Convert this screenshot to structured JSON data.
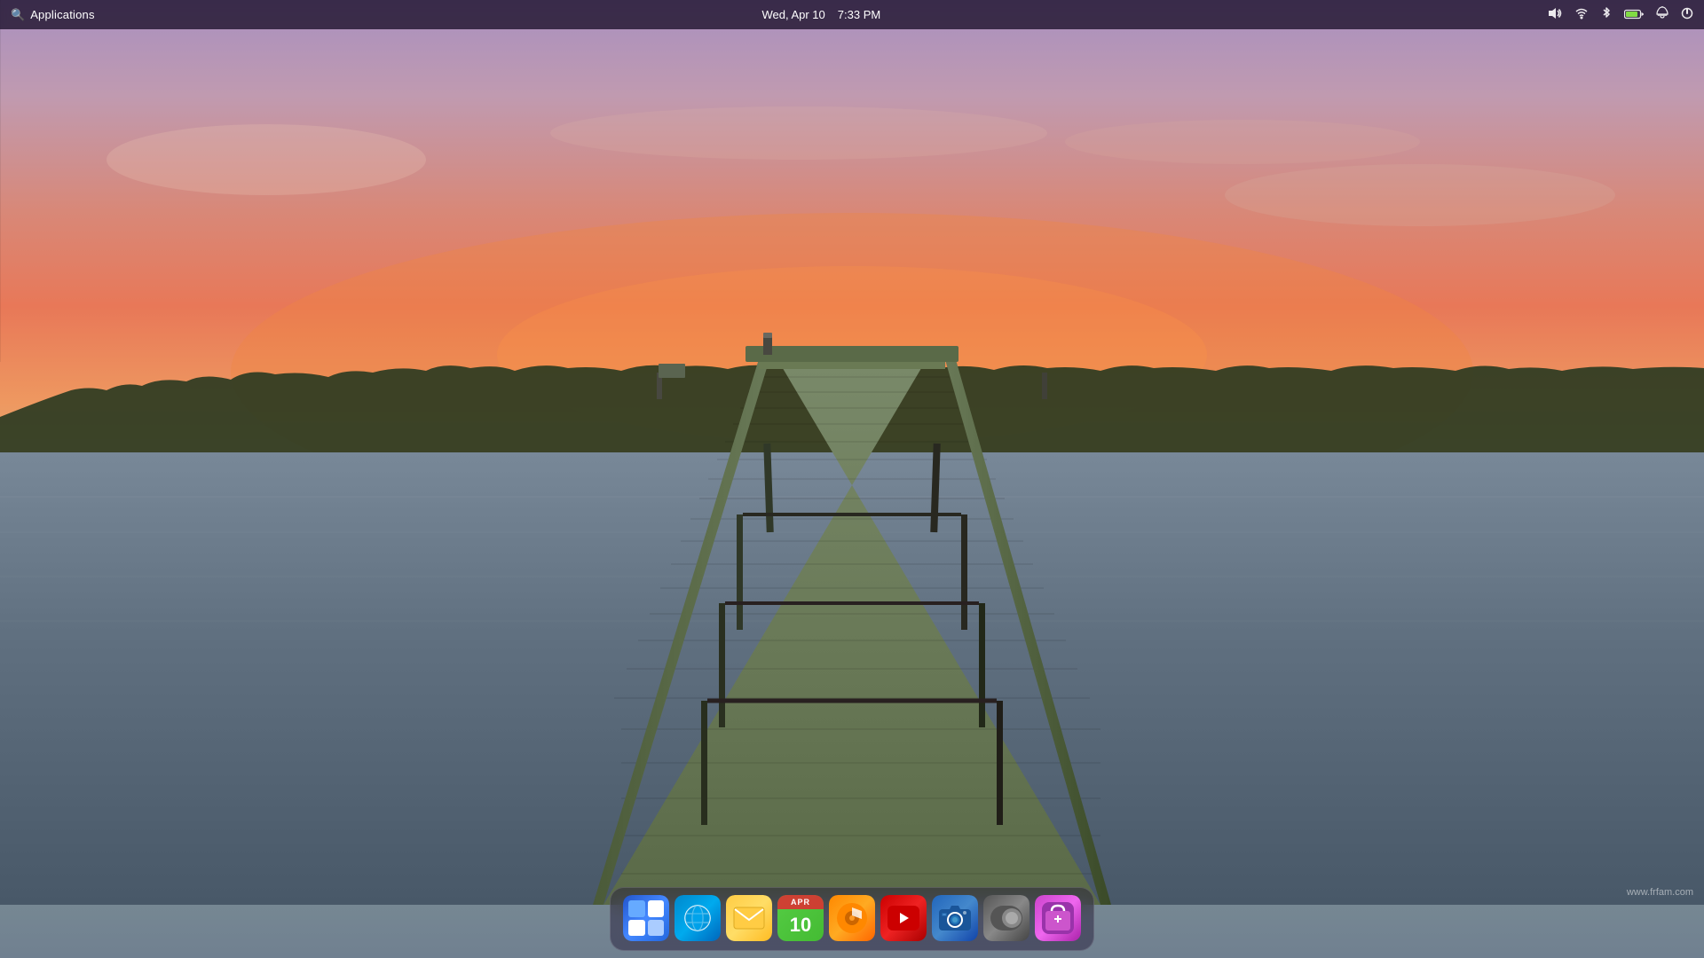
{
  "desktop": {
    "watermark": "www.frfam.com"
  },
  "menubar": {
    "apps_label": "Applications",
    "date": "Wed, Apr 10",
    "time": "7:33 PM",
    "icons": {
      "volume": "🔊",
      "wifi": "wifi-icon",
      "bluetooth": "bluetooth-icon",
      "battery": "battery-icon",
      "notifications": "bell-icon",
      "power": "power-icon"
    }
  },
  "dock": {
    "items": [
      {
        "id": "mosaic",
        "label": "Mosaic App",
        "type": "mosaic"
      },
      {
        "id": "browser",
        "label": "Web Browser",
        "type": "globe",
        "icon": "🌐"
      },
      {
        "id": "mail",
        "label": "Mail",
        "type": "mail",
        "icon": "✉"
      },
      {
        "id": "calendar",
        "label": "Calendar",
        "type": "calendar",
        "top_label": "APR",
        "day": "10"
      },
      {
        "id": "music",
        "label": "Music Player",
        "type": "music",
        "icon": "♪"
      },
      {
        "id": "youtube",
        "label": "YouTube",
        "type": "youtube",
        "icon": "▶"
      },
      {
        "id": "camera",
        "label": "Camera/Photos",
        "type": "camera",
        "icon": "📷"
      },
      {
        "id": "settings",
        "label": "System Settings",
        "type": "settings",
        "icon": "⚙"
      },
      {
        "id": "store",
        "label": "App Store",
        "type": "store",
        "icon": "🛍"
      }
    ]
  }
}
